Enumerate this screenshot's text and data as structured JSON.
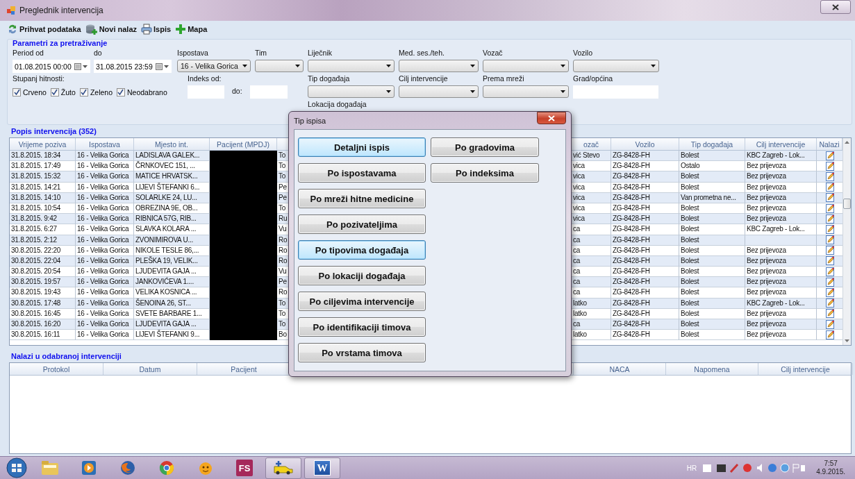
{
  "window": {
    "title": "Preglednik intervencija"
  },
  "toolbar": [
    "Prihvat podataka",
    "Novi nalaz",
    "Ispis",
    "Mapa"
  ],
  "parameters": {
    "title": "Parametri za pretraživanje",
    "row1": [
      {
        "label": "Period od",
        "kind": "date",
        "value": "01.08.2015 00:00"
      },
      {
        "label": "do",
        "kind": "date",
        "value": "31.08.2015 23:59"
      },
      {
        "label": "Ispostava",
        "kind": "combo",
        "value": "16 - Velika Gorica"
      },
      {
        "label": "Tim",
        "kind": "combo"
      },
      {
        "label": "Liječnik",
        "kind": "combo"
      },
      {
        "label": "Med. ses./teh.",
        "kind": "combo"
      },
      {
        "label": "Vozač",
        "kind": "combo"
      },
      {
        "label": "Vozilo",
        "kind": "combo"
      }
    ],
    "urgency_label": "Stupanj hitnosti:",
    "urgency": [
      {
        "label": "Crveno",
        "checked": true
      },
      {
        "label": "Žuto",
        "checked": true
      },
      {
        "label": "Zeleno",
        "checked": true
      },
      {
        "label": "Neodabrano",
        "checked": true
      }
    ],
    "index_from_label": "Indeks od:",
    "index_to_label": "do:",
    "row2": [
      {
        "label": "Tip događaja",
        "kind": "combo"
      },
      {
        "label": "Cilj intervencije",
        "kind": "combo"
      },
      {
        "label": "Prema mreži",
        "kind": "combo"
      },
      {
        "label": "Grad/općina",
        "kind": "text"
      }
    ],
    "location_label": "Lokacija događaja"
  },
  "interventions": {
    "title": "Popis intervencija (352)",
    "patient_redacted": true,
    "columns": [
      "Vrijeme poziva",
      "Ispostava",
      "Mjesto int.",
      "Pacijent (MPDJ)",
      "ozač",
      "Vozilo",
      "Tip događaja",
      "Cilj intervencije",
      "Nalazi"
    ],
    "rows": [
      {
        "time": "31.8.2015. 18:34",
        "station": "16 - Velika Gorica",
        "place": "LADISLAVA GALEK...",
        "column_5": "To",
        "driver": "vić Stevo",
        "vehicle": "ZG-8428-FH",
        "event_type": "Bolest",
        "goal": "KBC Zagreb - Lok..."
      },
      {
        "time": "31.8.2015. 17:49",
        "station": "16 - Velika Gorica",
        "place": "ČRNKOVEC 151, ...",
        "column_5": "To",
        "driver": "vica",
        "vehicle": "ZG-8428-FH",
        "event_type": "Ostalo",
        "goal": "Bez prijevoza"
      },
      {
        "time": "31.8.2015. 15:32",
        "station": "16 - Velika Gorica",
        "place": "MATICE HRVATSK...",
        "column_5": "To",
        "driver": "vica",
        "vehicle": "ZG-8428-FH",
        "event_type": "Bolest",
        "goal": "Bez prijevoza"
      },
      {
        "time": "31.8.2015. 14:21",
        "station": "16 - Velika Gorica",
        "place": "LIJEVI ŠTEFANKI 6...",
        "column_5": "Pe",
        "driver": "vica",
        "vehicle": "ZG-8428-FH",
        "event_type": "Bolest",
        "goal": "Bez prijevoza"
      },
      {
        "time": "31.8.2015. 14:10",
        "station": "16 - Velika Gorica",
        "place": "SOLARLKE 24, LU...",
        "column_5": "Pe",
        "driver": "vica",
        "vehicle": "ZG-8428-FH",
        "event_type": "Van prometna ne...",
        "goal": "Bez prijevoza"
      },
      {
        "time": "31.8.2015. 10:54",
        "station": "16 - Velika Gorica",
        "place": "OBREZINA 9E, OB...",
        "column_5": "To",
        "driver": "vica",
        "vehicle": "ZG-8428-FH",
        "event_type": "Bolest",
        "goal": "Bez prijevoza"
      },
      {
        "time": "31.8.2015. 9:42",
        "station": "16 - Velika Gorica",
        "place": "RIBNICA 57G, RIB...",
        "column_5": "Ru",
        "driver": "vica",
        "vehicle": "ZG-8428-FH",
        "event_type": "Bolest",
        "goal": "Bez prijevoza"
      },
      {
        "time": "31.8.2015. 6:27",
        "station": "16 - Velika Gorica",
        "place": "SLAVKA KOLARA ...",
        "column_5": "Vu",
        "driver": "ca",
        "vehicle": "ZG-8428-FH",
        "event_type": "Bolest",
        "goal": "KBC Zagreb - Lok..."
      },
      {
        "time": "31.8.2015. 2:12",
        "station": "16 - Velika Gorica",
        "place": "ZVONIMIROVA U...",
        "column_5": "Ro",
        "driver": "ca",
        "vehicle": "ZG-8428-FH",
        "event_type": "Bolest"
      },
      {
        "time": "30.8.2015. 22:20",
        "station": "16 - Velika Gorica",
        "place": "NIKOLE TESLE  86,...",
        "column_5": "Ro",
        "driver": "ca",
        "vehicle": "ZG-8428-FH",
        "event_type": "Bolest",
        "goal": "Bez prijevoza"
      },
      {
        "time": "30.8.2015. 22:04",
        "station": "16 - Velika Gorica",
        "place": "PLEŠKA  19, VELIK...",
        "column_5": "Ro",
        "driver": "ca",
        "vehicle": "ZG-8428-FH",
        "event_type": "Bolest",
        "goal": "Bez prijevoza"
      },
      {
        "time": "30.8.2015. 20:54",
        "station": "16 - Velika Gorica",
        "place": "LJUDEVITA GAJA ...",
        "column_5": "Vu",
        "driver": "ca",
        "vehicle": "ZG-8428-FH",
        "event_type": "Bolest",
        "goal": "Bez prijevoza"
      },
      {
        "time": "30.8.2015. 19:57",
        "station": "16 - Velika Gorica",
        "place": "JANKOVIĆEVA 1....",
        "column_5": "Pe",
        "driver": "ca",
        "vehicle": "ZG-8428-FH",
        "event_type": "Bolest",
        "goal": "Bez prijevoza"
      },
      {
        "time": "30.8.2015. 19:43",
        "station": "16 - Velika Gorica",
        "place": "VELIKA KOSNICA ...",
        "column_5": "Ro",
        "driver": "ca",
        "vehicle": "ZG-8428-FH",
        "event_type": "Bolest",
        "goal": "Bez prijevoza"
      },
      {
        "time": "30.8.2015. 17:48",
        "station": "16 - Velika Gorica",
        "place": "ŠENOINA   26, ST...",
        "column_5": "To",
        "driver": "latko",
        "vehicle": "ZG-8428-FH",
        "event_type": "Bolest",
        "goal": "KBC Zagreb - Lok..."
      },
      {
        "time": "30.8.2015. 16:45",
        "station": "16 - Velika Gorica",
        "place": "SVETE BARBARE 1...",
        "column_5": "To",
        "driver": "latko",
        "vehicle": "ZG-8428-FH",
        "event_type": "Bolest",
        "goal": "Bez prijevoza"
      },
      {
        "time": "30.8.2015. 16:20",
        "station": "16 - Velika Gorica",
        "place": "LJUDEVITA GAJA ...",
        "column_5": "To",
        "driver": "ca",
        "vehicle": "ZG-8428-FH",
        "event_type": "Bolest",
        "goal": "Bez prijevoza"
      },
      {
        "time": "30.8.2015. 16:11",
        "station": "16 - Velika Gorica",
        "place": "LIJEVI ŠTEFANKI 9...",
        "column_5": "Bo",
        "driver": "latko",
        "vehicle": "ZG-8428-FH",
        "event_type": "Bolest",
        "goal": "Bez prijevoza"
      }
    ]
  },
  "findings": {
    "title": "Nalazi u odabranoj intervenciji",
    "columns_left": [
      "Protokol",
      "Datum",
      "Pacijent"
    ],
    "columns_right": [
      "NACA",
      "Napomena",
      "Cilj intervencije"
    ]
  },
  "dialog": {
    "title": "Tip ispisa",
    "columns": [
      [
        {
          "label": "Detaljni ispis",
          "highlighted": true
        },
        {
          "label": "Po ispostavama",
          "highlighted": false
        },
        {
          "label": "Po mreži hitne medicine",
          "highlighted": false
        },
        {
          "label": "Po pozivateljima",
          "highlighted": false
        },
        {
          "label": "Po tipovima događaja",
          "highlighted": true
        },
        {
          "label": "Po lokaciji događaja",
          "highlighted": false
        },
        {
          "label": "Po ciljevima intervencije",
          "highlighted": false
        },
        {
          "label": "Po identifikaciji timova",
          "highlighted": false
        },
        {
          "label": "Po vrstama timova",
          "highlighted": false
        }
      ],
      [
        {
          "label": "Po gradovima",
          "highlighted": false
        },
        {
          "label": "Po indeksima",
          "highlighted": false
        }
      ]
    ]
  },
  "taskbar": {
    "apps": [
      {
        "kind": "folder",
        "active": false
      },
      {
        "kind": "player",
        "active": false
      },
      {
        "kind": "firefox",
        "active": false
      },
      {
        "kind": "chrome",
        "active": false
      },
      {
        "kind": "smiley",
        "active": false
      },
      {
        "kind": "fs",
        "label": "FS",
        "active": false
      },
      {
        "kind": "ambulance",
        "active": true
      },
      {
        "kind": "word",
        "label": "W",
        "active": true
      }
    ],
    "language": "HR",
    "time": "7:57",
    "date": "4.9.2015."
  }
}
